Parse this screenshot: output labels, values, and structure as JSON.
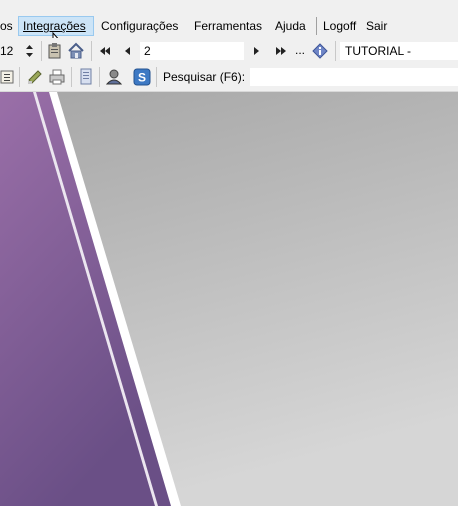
{
  "menu": {
    "items": [
      {
        "id": "menu-partial",
        "label": "os"
      },
      {
        "id": "menu-integracoes",
        "label": "Integrações"
      },
      {
        "id": "menu-configuracoes",
        "label": "Configurações"
      },
      {
        "id": "menu-ferramentas",
        "label": "Ferramentas"
      },
      {
        "id": "menu-ajuda",
        "label": "Ajuda"
      },
      {
        "id": "menu-logoff",
        "label": "Logoff"
      },
      {
        "id": "menu-sair",
        "label": "Sair"
      }
    ]
  },
  "toolbar": {
    "spinner_value": "12",
    "record_value": "2",
    "ellipsis": "...",
    "company_label": "TUTORIAL -",
    "search_label": "Pesquisar (F6):"
  },
  "colors": {
    "purple_top": "#9a6fa8",
    "purple_bottom": "#6a4f86",
    "gray_top": "#a6a6a6",
    "gray_bottom": "#d6d6d6",
    "menu_highlight": "#cce4f7"
  },
  "icons": [
    "spin-up-icon",
    "spin-down-icon",
    "clipboard-icon",
    "home-icon",
    "first-record-icon",
    "previous-record-icon",
    "next-record-icon",
    "last-record-icon",
    "info-icon",
    "list-icon",
    "notes-icon",
    "print-icon",
    "document-icon",
    "user-icon",
    "skype-icon"
  ]
}
